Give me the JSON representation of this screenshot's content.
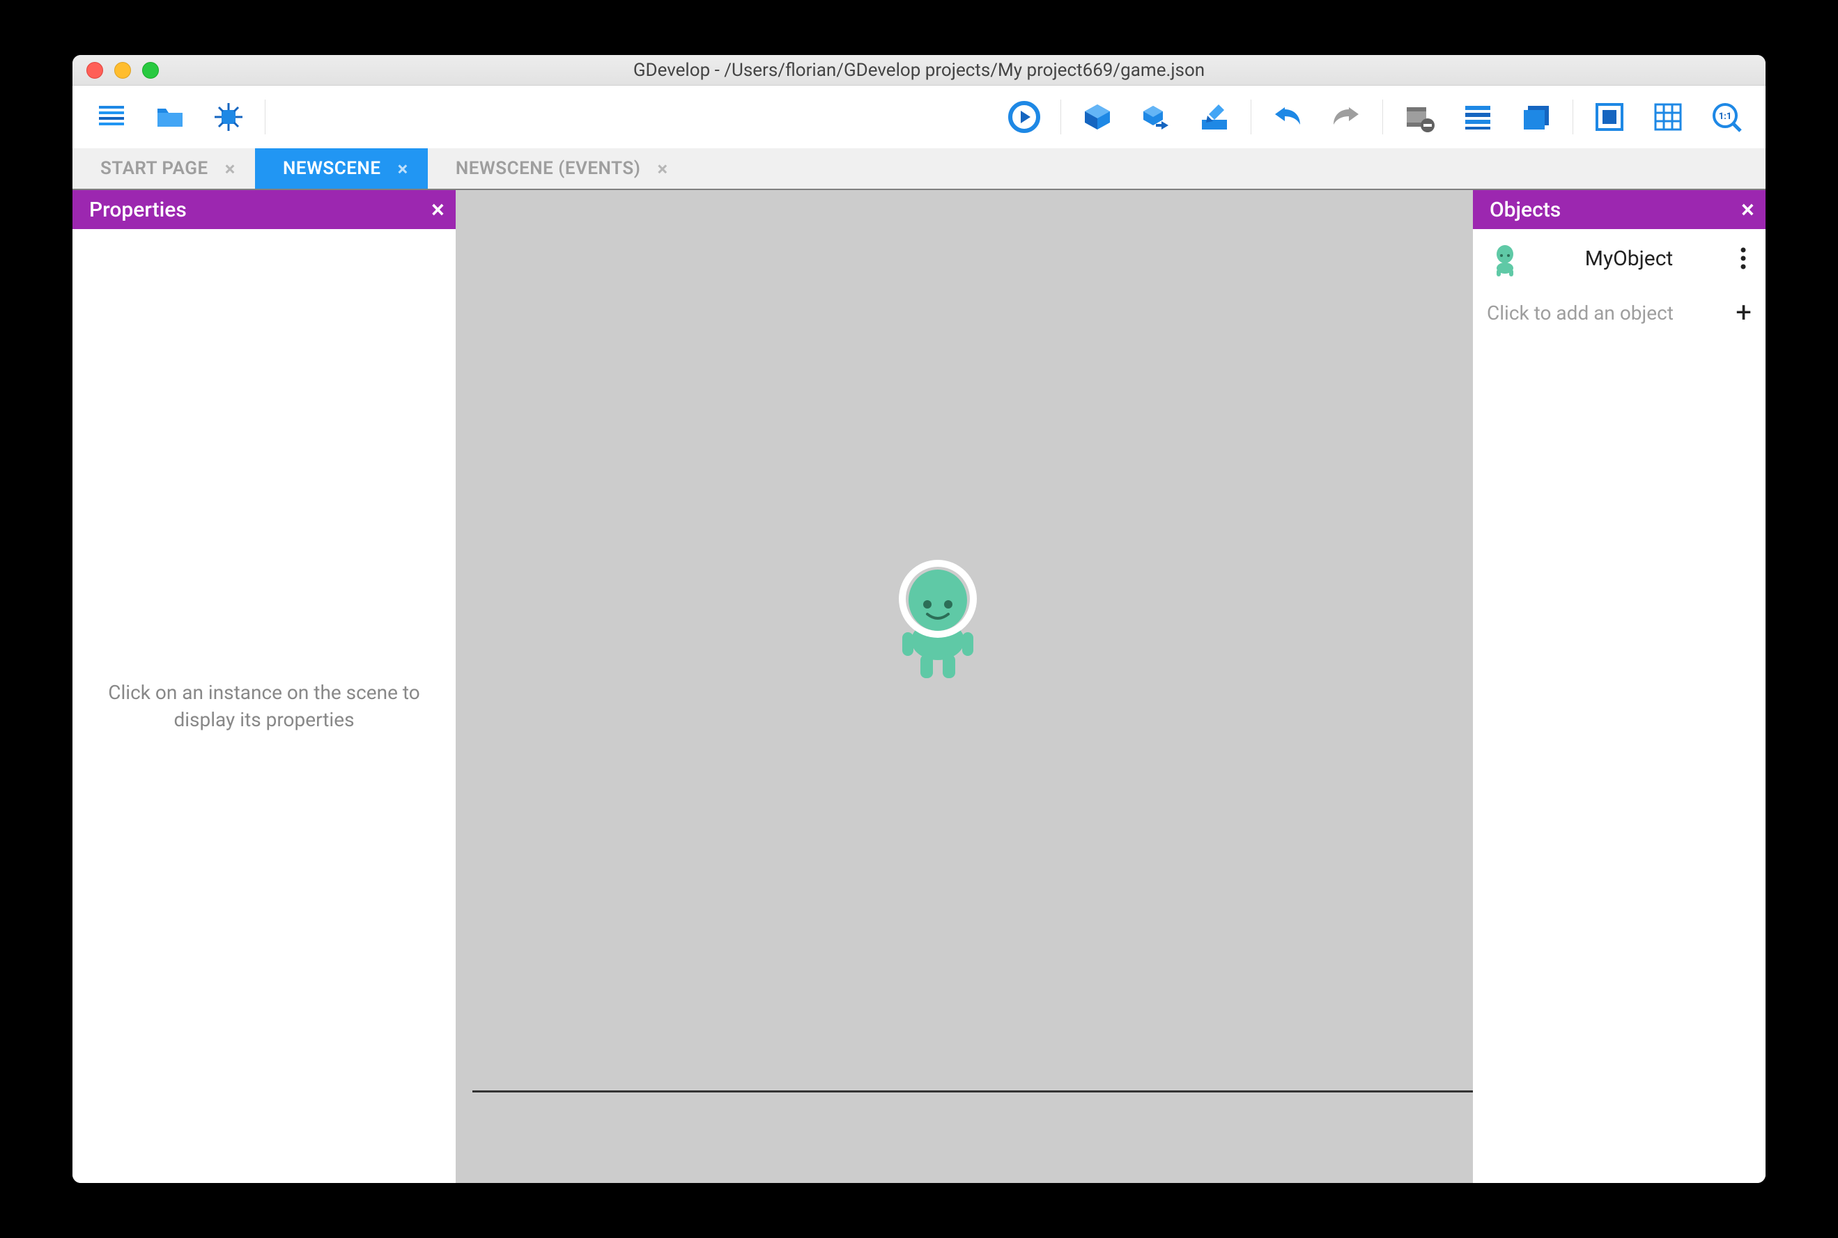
{
  "window": {
    "title": "GDevelop - /Users/florian/GDevelop projects/My project669/game.json"
  },
  "toolbar": {
    "left": [
      {
        "name": "project-manager",
        "icon": "list"
      },
      {
        "name": "open-project",
        "icon": "folder"
      },
      {
        "name": "debug",
        "icon": "chip"
      }
    ],
    "right": [
      {
        "name": "play",
        "icon": "play"
      },
      {
        "name": "add-object",
        "icon": "cube-plus"
      },
      {
        "name": "add-instance",
        "icon": "cube-arrow"
      },
      {
        "name": "edit",
        "icon": "pencil"
      },
      {
        "name": "undo",
        "icon": "undo"
      },
      {
        "name": "redo",
        "icon": "redo"
      },
      {
        "name": "delete",
        "icon": "film-minus"
      },
      {
        "name": "layers",
        "icon": "lines"
      },
      {
        "name": "windows",
        "icon": "windowstack"
      },
      {
        "name": "mask",
        "icon": "mask"
      },
      {
        "name": "grid",
        "icon": "grid"
      },
      {
        "name": "zoom-reset",
        "icon": "zoom11"
      }
    ]
  },
  "tabs": [
    {
      "label": "START PAGE",
      "active": false,
      "closable": true
    },
    {
      "label": "NEWSCENE",
      "active": true,
      "closable": true
    },
    {
      "label": "NEWSCENE (EVENTS)",
      "active": false,
      "closable": true
    }
  ],
  "panels": {
    "properties": {
      "title": "Properties",
      "placeholder": "Click on an instance on the scene to display its properties"
    },
    "objects": {
      "title": "Objects",
      "items": [
        {
          "name": "MyObject"
        }
      ],
      "add_label": "Click to add an object"
    }
  }
}
